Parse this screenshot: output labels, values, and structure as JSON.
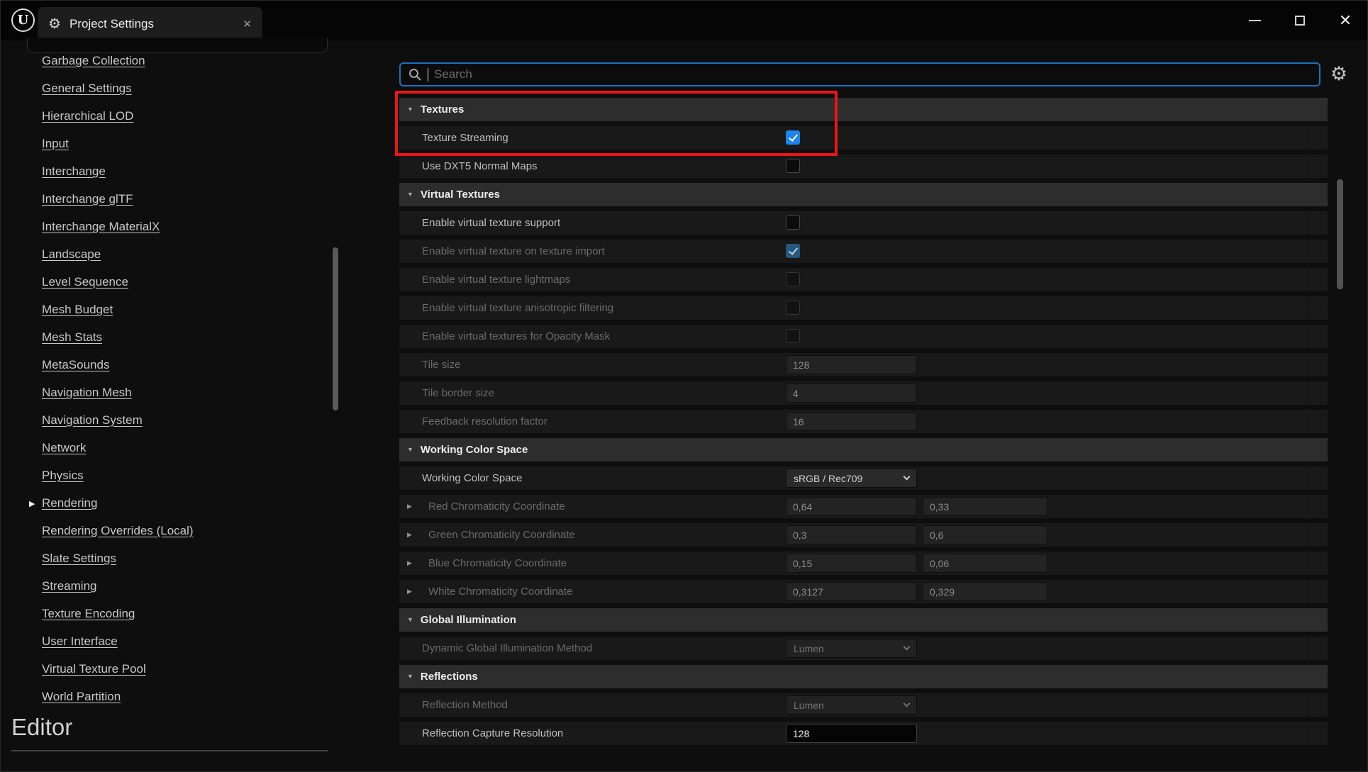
{
  "titlebar": {
    "tab_title": "Project Settings"
  },
  "icons": {
    "collapse_down": "▼",
    "expand_right": "▶",
    "gear": "⚙",
    "tab_gear": "⚙",
    "close": "✕",
    "unreal_logo_letter": "U"
  },
  "colors": {
    "accent_blue": "#1c86ee",
    "search_focus_border": "#1d70bd",
    "annotation_red": "#ed1515",
    "header_row_bg": "#2d2d2d",
    "property_row_bg": "#191919"
  },
  "sidebar": {
    "items": [
      "Garbage Collection",
      "General Settings",
      "Hierarchical LOD",
      "Input",
      "Interchange",
      "Interchange glTF",
      "Interchange MaterialX",
      "Landscape",
      "Level Sequence",
      "Mesh Budget",
      "Mesh Stats",
      "MetaSounds",
      "Navigation Mesh",
      "Navigation System",
      "Network",
      "Physics",
      "Rendering",
      "Rendering Overrides (Local)",
      "Slate Settings",
      "Streaming",
      "Texture Encoding",
      "User Interface",
      "Virtual Texture Pool",
      "World Partition"
    ],
    "footer_heading": "Editor"
  },
  "search": {
    "placeholder": "Search"
  },
  "rows": [
    {
      "type": "section-header",
      "label": "Textures"
    },
    {
      "type": "checkbox",
      "label": "Texture Streaming",
      "checked": true,
      "enabled": true
    },
    {
      "type": "checkbox",
      "label": "Use DXT5 Normal Maps",
      "checked": false,
      "enabled": true
    },
    {
      "type": "section-header",
      "label": "Virtual Textures"
    },
    {
      "type": "checkbox",
      "label": "Enable virtual texture support",
      "checked": false,
      "enabled": true
    },
    {
      "type": "checkbox",
      "label": "Enable virtual texture on texture import",
      "checked": true,
      "enabled": false
    },
    {
      "type": "checkbox",
      "label": "Enable virtual texture lightmaps",
      "checked": false,
      "enabled": false
    },
    {
      "type": "checkbox",
      "label": "Enable virtual texture anisotropic filtering",
      "checked": false,
      "enabled": false
    },
    {
      "type": "checkbox",
      "label": "Enable virtual textures for Opacity Mask",
      "checked": false,
      "enabled": false
    },
    {
      "type": "number-field",
      "label": "Tile size",
      "value": "128",
      "enabled": false
    },
    {
      "type": "number-field",
      "label": "Tile border size",
      "value": "4",
      "enabled": false
    },
    {
      "type": "number-field",
      "label": "Feedback resolution factor",
      "value": "16",
      "enabled": false
    },
    {
      "type": "section-header",
      "label": "Working Color Space"
    },
    {
      "type": "dropdown",
      "label": "Working Color Space",
      "value": "sRGB / Rec709",
      "enabled": true
    },
    {
      "type": "vector2-field",
      "label": "Red Chromaticity Coordinate",
      "values": [
        "0,64",
        "0,33"
      ],
      "enabled": false
    },
    {
      "type": "vector2-field",
      "label": "Green Chromaticity Coordinate",
      "values": [
        "0,3",
        "0,6"
      ],
      "enabled": false
    },
    {
      "type": "vector2-field",
      "label": "Blue Chromaticity Coordinate",
      "values": [
        "0,15",
        "0,06"
      ],
      "enabled": false
    },
    {
      "type": "vector2-field",
      "label": "White Chromaticity Coordinate",
      "values": [
        "0,3127",
        "0,329"
      ],
      "enabled": false
    },
    {
      "type": "section-header",
      "label": "Global Illumination"
    },
    {
      "type": "dropdown",
      "label": "Dynamic Global Illumination Method",
      "value": "Lumen",
      "enabled": false
    },
    {
      "type": "section-header",
      "label": "Reflections"
    },
    {
      "type": "dropdown",
      "label": "Reflection Method",
      "value": "Lumen",
      "enabled": false
    },
    {
      "type": "number-field",
      "label": "Reflection Capture Resolution",
      "value": "128",
      "enabled": true
    }
  ]
}
